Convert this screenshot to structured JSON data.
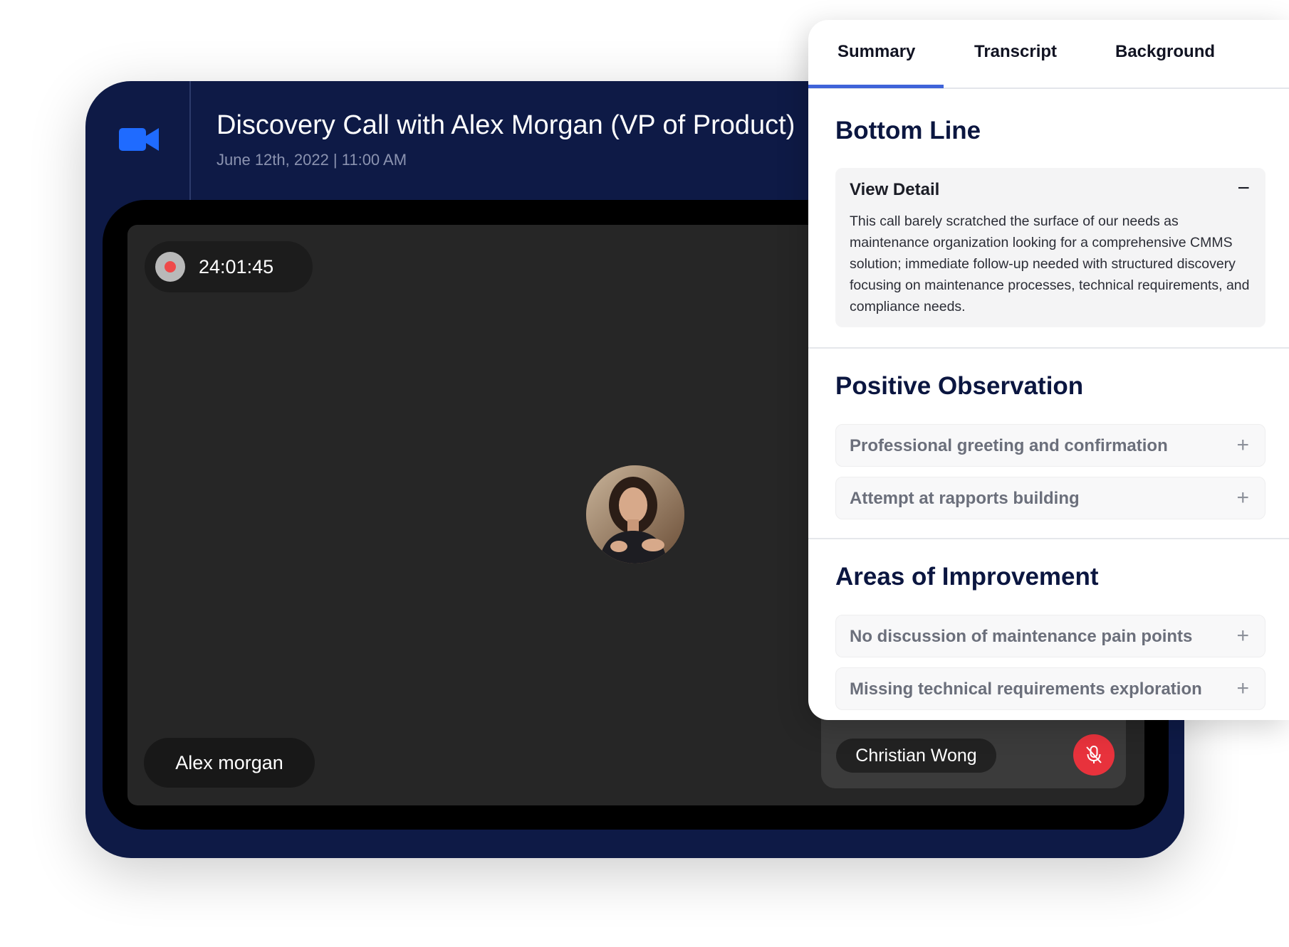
{
  "call": {
    "title": "Discovery Call with Alex Morgan (VP of Product)",
    "date": "June 12th, 2022 | 11:00 AM"
  },
  "video": {
    "recording_time": "24:01:45",
    "participant_name": "Alex morgan",
    "self_name": "Christian Wong",
    "mic_state": "muted"
  },
  "panel": {
    "tabs": [
      {
        "label": "Summary",
        "active": true
      },
      {
        "label": "Transcript",
        "active": false
      },
      {
        "label": "Background",
        "active": false
      }
    ],
    "bottom_line": {
      "title": "Bottom Line",
      "detail_label": "View Detail",
      "toggle": "−",
      "text": "This call barely scratched the surface of our needs as maintenance organization looking for a comprehensive CMMS solution; immediate follow-up needed with structured discovery focusing on maintenance processes, technical requirements, and compliance needs."
    },
    "positive": {
      "title": "Positive Observation",
      "items": [
        "Professional greeting and confirmation",
        "Attempt at rapports building"
      ]
    },
    "improvement": {
      "title": "Areas of Improvement",
      "items": [
        "No discussion of maintenance pain points",
        "Missing technical requirements exploration"
      ]
    },
    "expand_glyph": "+"
  },
  "colors": {
    "card_bg": "#0e1a46",
    "accent": "#3f63d9",
    "camera_icon": "#1f6bff",
    "mic_button": "#e8323c",
    "rec_dot": "#ef4a4a"
  }
}
